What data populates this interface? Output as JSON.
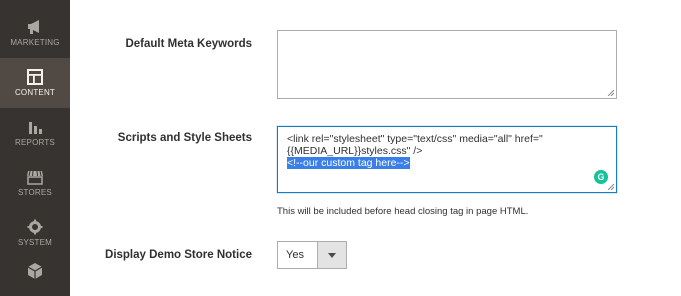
{
  "sidebar": {
    "items": [
      {
        "label": "MARKETING",
        "icon": "megaphone-icon"
      },
      {
        "label": "CONTENT",
        "icon": "content-layout-icon"
      },
      {
        "label": "REPORTS",
        "icon": "bar-chart-icon"
      },
      {
        "label": "STORES",
        "icon": "storefront-icon"
      },
      {
        "label": "SYSTEM",
        "icon": "gear-icon"
      },
      {
        "label": "",
        "icon": "package-box-icon"
      }
    ],
    "active": "CONTENT"
  },
  "fields": {
    "meta_keywords": {
      "label": "Default Meta Keywords",
      "value": ""
    },
    "scripts": {
      "label": "Scripts and Style Sheets",
      "lines": [
        "<link  rel=\"stylesheet\" type=\"text/css\"  media=\"all\" href=\"",
        "{{MEDIA_URL}}styles.css\" />",
        "<!--our custom tag here-->"
      ],
      "note": "This will be included before head closing tag in page HTML."
    },
    "demo_notice": {
      "label": "Display Demo Store Notice",
      "value": "Yes"
    }
  },
  "colors": {
    "sidebar_bg": "#373330",
    "active_bg": "#514943",
    "focus_border": "#1979c3",
    "selection": "#3a7ee8",
    "grammarly": "#15c39a"
  }
}
